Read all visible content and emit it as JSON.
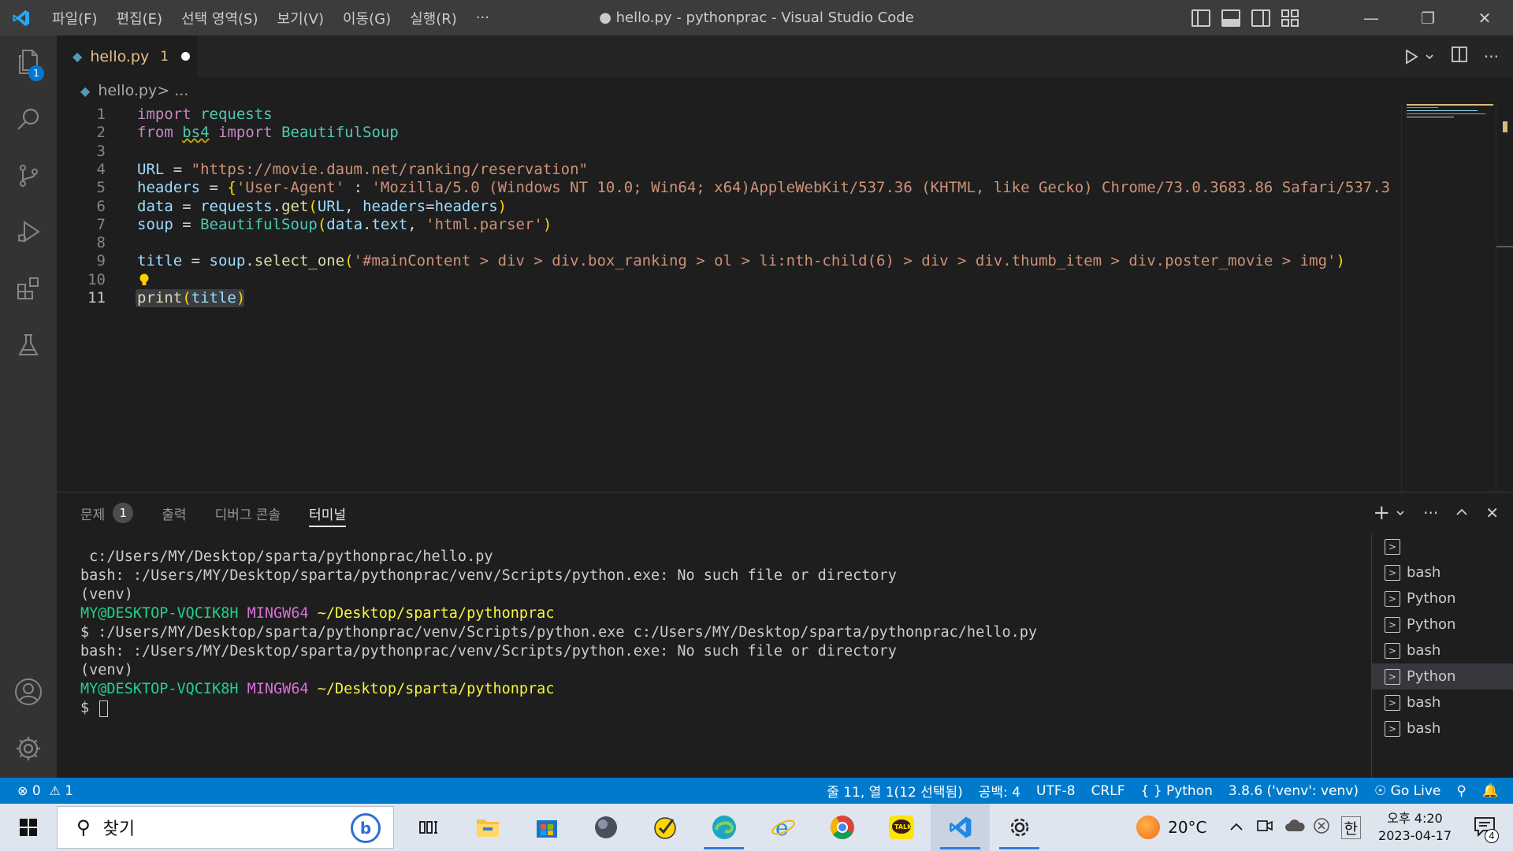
{
  "titlebar": {
    "menu": [
      "파일(F)",
      "편집(E)",
      "선택 영역(S)",
      "보기(V)",
      "이동(G)",
      "실행(R)",
      "···"
    ],
    "title": "● hello.py - pythonprac - Visual Studio Code"
  },
  "activitybar": {
    "explorer_badge": "1"
  },
  "tab": {
    "filename": "hello.py",
    "problems": "1"
  },
  "breadcrumb": {
    "file": "hello.py",
    "rest": " > ..."
  },
  "editor": {
    "line_numbers": [
      "1",
      "2",
      "3",
      "4",
      "5",
      "6",
      "7",
      "8",
      "9",
      "10",
      "11"
    ],
    "active_line": 11,
    "lines": [
      [
        {
          "c": "kw",
          "t": "import"
        },
        {
          "c": "pl",
          "t": " "
        },
        {
          "c": "mod",
          "t": "requests"
        }
      ],
      [
        {
          "c": "kw",
          "t": "from"
        },
        {
          "c": "pl",
          "t": " "
        },
        {
          "c": "mod",
          "t": "bs4"
        },
        {
          "c": "pl",
          "t": " "
        },
        {
          "c": "kw",
          "t": "import"
        },
        {
          "c": "pl",
          "t": " "
        },
        {
          "c": "mod",
          "t": "BeautifulSoup"
        }
      ],
      [],
      [
        {
          "c": "var",
          "t": "URL"
        },
        {
          "c": "pl",
          "t": " = "
        },
        {
          "c": "str",
          "t": "\"https://movie.daum.net/ranking/reservation\""
        }
      ],
      [
        {
          "c": "var",
          "t": "headers"
        },
        {
          "c": "pl",
          "t": " = "
        },
        {
          "c": "br1",
          "t": "{"
        },
        {
          "c": "str",
          "t": "'User-Agent'"
        },
        {
          "c": "pl",
          "t": " : "
        },
        {
          "c": "str",
          "t": "'Mozilla/5.0 (Windows NT 10.0; Win64; x64)AppleWebKit/537.36 (KHTML, like Gecko) Chrome/73.0.3683.86 Safari/537.3"
        }
      ],
      [
        {
          "c": "var",
          "t": "data"
        },
        {
          "c": "pl",
          "t": " = "
        },
        {
          "c": "var",
          "t": "requests"
        },
        {
          "c": "pl",
          "t": "."
        },
        {
          "c": "fn",
          "t": "get"
        },
        {
          "c": "br1",
          "t": "("
        },
        {
          "c": "var",
          "t": "URL"
        },
        {
          "c": "pl",
          "t": ", "
        },
        {
          "c": "var",
          "t": "headers"
        },
        {
          "c": "pl",
          "t": "="
        },
        {
          "c": "var",
          "t": "headers"
        },
        {
          "c": "br1",
          "t": ")"
        }
      ],
      [
        {
          "c": "var",
          "t": "soup"
        },
        {
          "c": "pl",
          "t": " = "
        },
        {
          "c": "mod",
          "t": "BeautifulSoup"
        },
        {
          "c": "br1",
          "t": "("
        },
        {
          "c": "var",
          "t": "data"
        },
        {
          "c": "pl",
          "t": "."
        },
        {
          "c": "var",
          "t": "text"
        },
        {
          "c": "pl",
          "t": ", "
        },
        {
          "c": "str",
          "t": "'html.parser'"
        },
        {
          "c": "br1",
          "t": ")"
        }
      ],
      [],
      [
        {
          "c": "var",
          "t": "title"
        },
        {
          "c": "pl",
          "t": " = "
        },
        {
          "c": "var",
          "t": "soup"
        },
        {
          "c": "pl",
          "t": "."
        },
        {
          "c": "fn",
          "t": "select_one"
        },
        {
          "c": "br1",
          "t": "("
        },
        {
          "c": "str",
          "t": "'#mainContent > div > div.box_ranking > ol > li:nth-child(6) > div > div.thumb_item > div.poster_movie > img'"
        },
        {
          "c": "br1",
          "t": ")"
        }
      ],
      [],
      [
        {
          "c": "fn",
          "t": "print"
        },
        {
          "c": "br1",
          "t": "("
        },
        {
          "c": "var",
          "t": "title"
        },
        {
          "c": "br1",
          "t": ")"
        }
      ]
    ]
  },
  "panel": {
    "tabs": [
      {
        "label": "문제",
        "badge": "1"
      },
      {
        "label": "출력"
      },
      {
        "label": "디버그 콘솔"
      },
      {
        "label": "터미널",
        "active": true
      }
    ],
    "terminal_lines": [
      [
        {
          "c": "",
          "t": " c:/Users/MY/Desktop/sparta/pythonprac/hello.py"
        }
      ],
      [
        {
          "c": "",
          "t": "bash: :/Users/MY/Desktop/sparta/pythonprac/venv/Scripts/python.exe: No such file or directory"
        }
      ],
      [
        {
          "c": "",
          "t": "(venv)"
        }
      ],
      [
        {
          "c": "t-green",
          "t": "MY@DESKTOP-VQCIK8H"
        },
        {
          "c": "",
          "t": " "
        },
        {
          "c": "t-mag",
          "t": "MINGW64"
        },
        {
          "c": "",
          "t": " "
        },
        {
          "c": "t-yel",
          "t": "~/Desktop/sparta/pythonprac"
        }
      ],
      [
        {
          "c": "",
          "t": "$ :/Users/MY/Desktop/sparta/pythonprac/venv/Scripts/python.exe c:/Users/MY/Desktop/sparta/pythonprac/hello.py"
        }
      ],
      [
        {
          "c": "",
          "t": "bash: :/Users/MY/Desktop/sparta/pythonprac/venv/Scripts/python.exe: No such file or directory"
        }
      ],
      [
        {
          "c": "",
          "t": "(venv)"
        }
      ],
      [
        {
          "c": "t-green",
          "t": "MY@DESKTOP-VQCIK8H"
        },
        {
          "c": "",
          "t": " "
        },
        {
          "c": "t-mag",
          "t": "MINGW64"
        },
        {
          "c": "",
          "t": " "
        },
        {
          "c": "t-yel",
          "t": "~/Desktop/sparta/pythonprac"
        }
      ],
      [
        {
          "c": "",
          "t": "$ "
        }
      ]
    ],
    "terminals": [
      {
        "label": ""
      },
      {
        "label": "bash"
      },
      {
        "label": "Python"
      },
      {
        "label": "Python"
      },
      {
        "label": "bash"
      },
      {
        "label": "Python",
        "selected": true
      },
      {
        "label": "bash"
      },
      {
        "label": "bash"
      }
    ]
  },
  "statusbar": {
    "errors": "0",
    "warnings": "1",
    "position": "줄 11, 열 1(12 선택됨)",
    "spaces": "공백: 4",
    "encoding": "UTF-8",
    "eol": "CRLF",
    "language": "Python",
    "interpreter": "3.8.6 ('venv': venv)",
    "golive": "Go Live"
  },
  "taskbar": {
    "search_placeholder": "찾기",
    "weather": "20°C",
    "ime": "한",
    "time": "오후 4:20",
    "date": "2023-04-17",
    "notifications": "4"
  },
  "colors": {
    "statusbar": "#007acc",
    "activitybar": "#333333",
    "editor_bg": "#1e1e1e"
  }
}
